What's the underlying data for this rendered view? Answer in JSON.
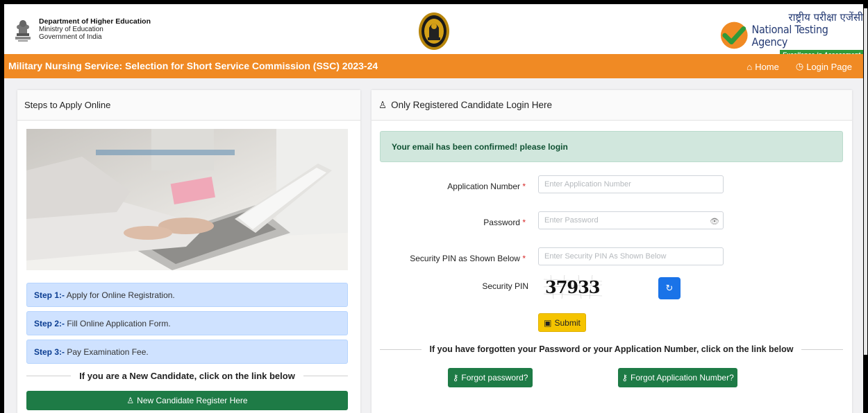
{
  "header": {
    "dept_title": "Department of Higher Education",
    "ministry": "Ministry of Education",
    "govt": "Government of India",
    "nta_hindi": "राष्ट्रीय परीक्षा एजेंसी",
    "nta_english": "National Testing Agency",
    "nta_tagline": "Excellence in Assessment"
  },
  "navbar": {
    "title": "Military Nursing Service: Selection for Short Service Commission (SSC) 2023-24",
    "home_label": "Home",
    "login_label": "Login Page",
    "color": "#f08a24"
  },
  "left_panel": {
    "title": "Steps to Apply Online",
    "steps": [
      {
        "num": "Step 1:-",
        "text": " Apply for Online Registration."
      },
      {
        "num": "Step 2:-",
        "text": " Fill Online Application Form."
      },
      {
        "num": "Step 3:-",
        "text": " Pay Examination Fee."
      }
    ],
    "new_candidate_text": "If you are a New Candidate, click on the link below",
    "register_button": "New Candidate Register Here"
  },
  "right_panel": {
    "title": "Only Registered Candidate Login Here",
    "alert": "Your email has been confirmed! please login",
    "fields": {
      "app_number_label": "Application Number",
      "app_number_placeholder": "Enter Application Number",
      "password_label": "Password",
      "password_placeholder": "Enter Password",
      "pin_label": "Security PIN as Shown Below",
      "pin_placeholder": "Enter Security PIN As Shown Below",
      "security_pin_label": "Security PIN",
      "required_mark": "*"
    },
    "captcha_value": "37933",
    "submit_label": "Submit",
    "forgot_text": "If you have forgotten your Password or your Application Number, click on the link below",
    "forgot_password_button": "Forgot password?",
    "forgot_appno_button": "Forgot Application Number?"
  }
}
